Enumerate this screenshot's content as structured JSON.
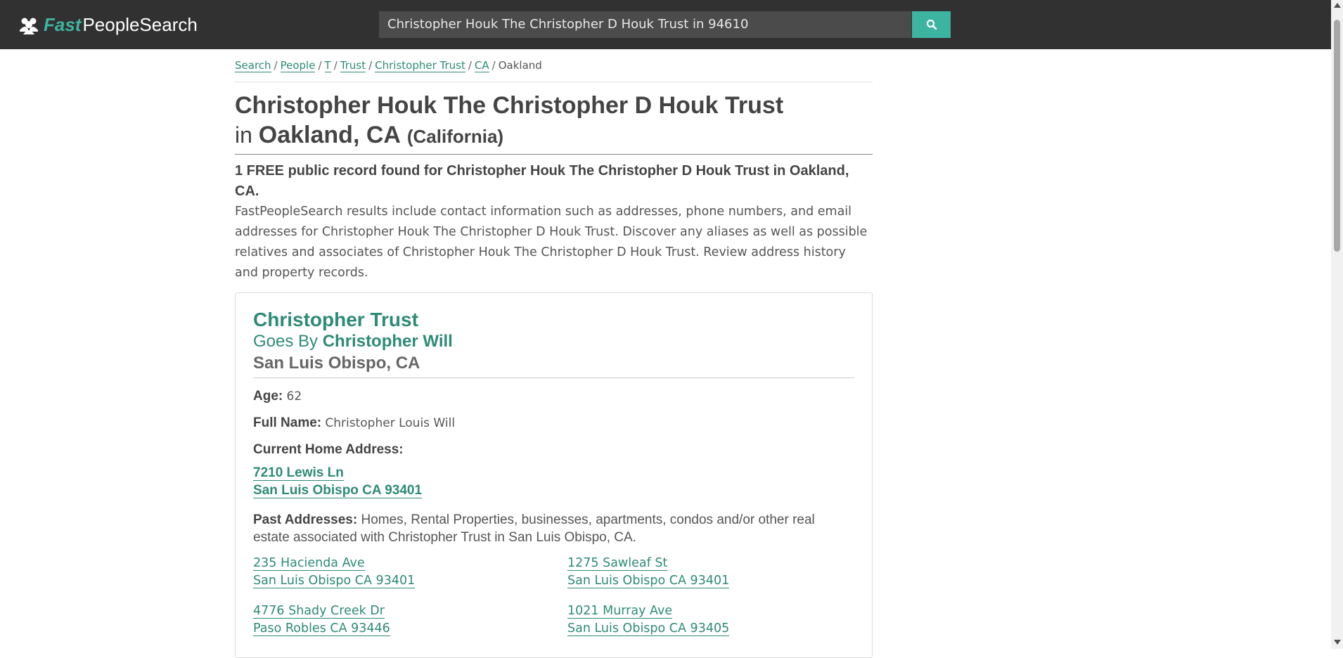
{
  "header": {
    "logo_fast": "Fast",
    "logo_people": "PeopleSearch",
    "search_value": "Christopher Houk The Christopher D Houk Trust in 94610",
    "search_icon": "search-icon"
  },
  "breadcrumb": {
    "items": [
      "Search",
      "People",
      "T",
      "Trust",
      "Christopher Trust",
      "CA"
    ],
    "current": "Oakland",
    "separator": "/"
  },
  "title": {
    "line1": "Christopher Houk The Christopher D Houk Trust",
    "in": "in",
    "city": "Oakland, CA",
    "state": "(California)"
  },
  "summary": "1 FREE public record found for Christopher Houk The Christopher D Houk Trust in Oakland, CA.",
  "description": "FastPeopleSearch results include contact information such as addresses, phone numbers, and email addresses for Christopher Houk The Christopher D Houk Trust. Discover any aliases as well as possible relatives and associates of Christopher Houk The Christopher D Houk Trust. Review address history and property records.",
  "card": {
    "name": "Christopher Trust",
    "goes_by_label": "Goes By",
    "goes_by": "Christopher Will",
    "location": "San Luis Obispo, CA",
    "age_label": "Age:",
    "age": "62",
    "full_name_label": "Full Name:",
    "full_name": "Christopher Louis Will",
    "home_label": "Current Home Address:",
    "home_line1": "7210 Lewis Ln",
    "home_line2": "San Luis Obispo CA 93401",
    "past_label": "Past Addresses:",
    "past_text": "Homes, Rental Properties, businesses, apartments, condos and/or other real estate associated with Christopher Trust in San Luis Obispo, CA.",
    "past_addresses": [
      {
        "line1": "235 Hacienda Ave",
        "line2": "San Luis Obispo CA 93401"
      },
      {
        "line1": "1275 Sawleaf St",
        "line2": "San Luis Obispo CA 93401"
      },
      {
        "line1": "4776 Shady Creek Dr",
        "line2": "Paso Robles CA 93446"
      },
      {
        "line1": "1021 Murray Ave",
        "line2": "San Luis Obispo CA 93405"
      }
    ]
  },
  "colors": {
    "header_bg": "#313131",
    "accent": "#3cb4a0",
    "link": "#2e8b76"
  }
}
